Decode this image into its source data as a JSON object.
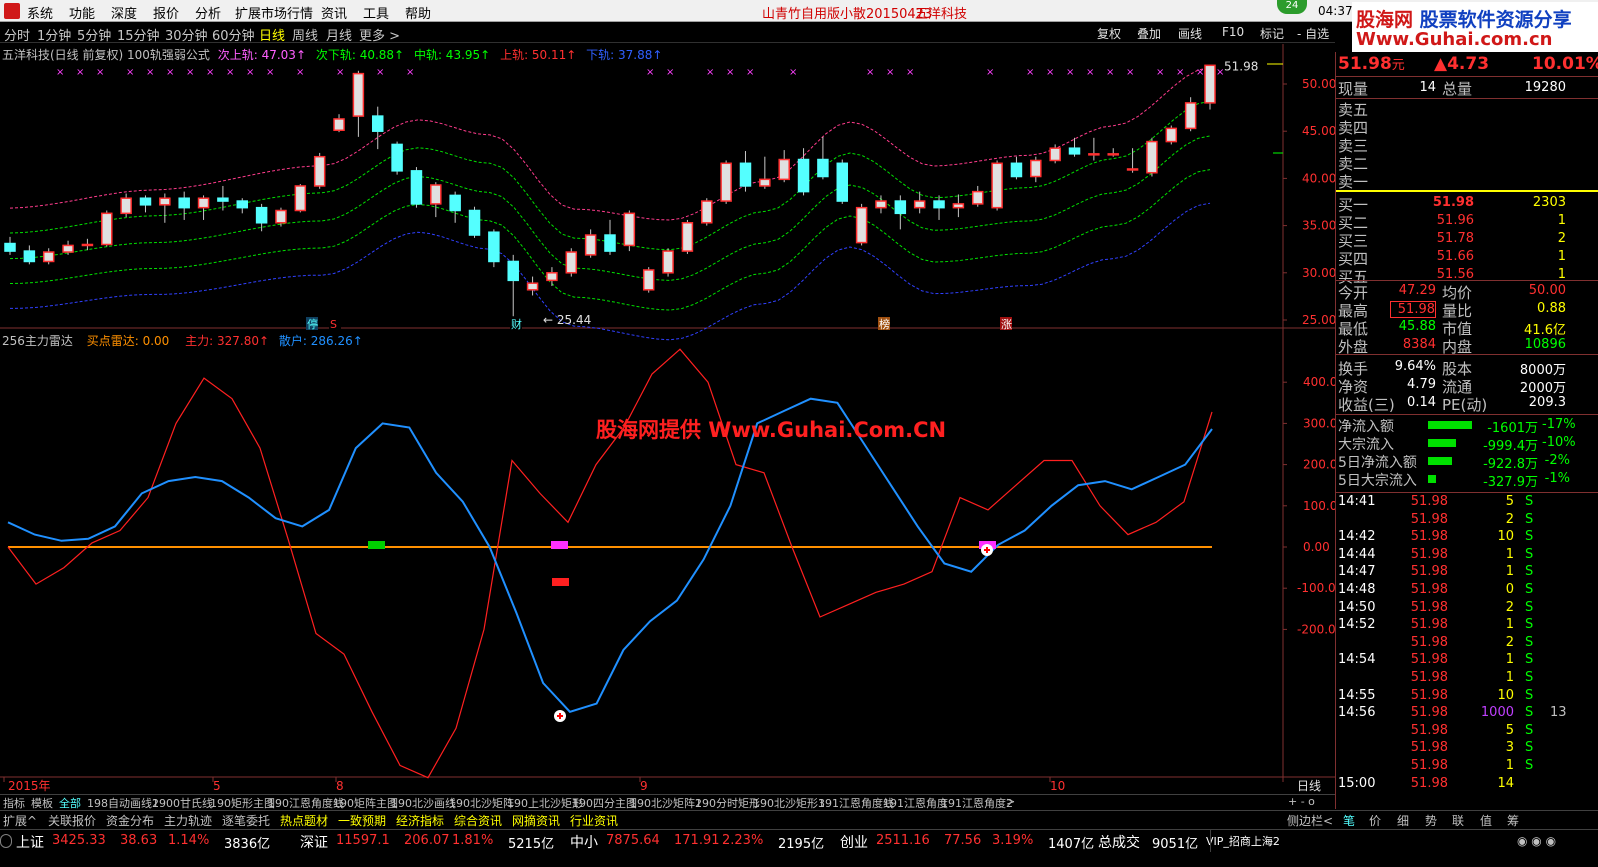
{
  "menu": {
    "items": [
      "系统",
      "功能",
      "深度",
      "报价",
      "分析",
      "扩展市场行情",
      "资讯",
      "工具",
      "帮助"
    ],
    "center_title": "山青竹自用版小散20150423",
    "stock_title": "五洋科技",
    "badge": "24",
    "clock": "04:37",
    "weekday": "周二"
  },
  "ad": {
    "line1_a": "股海网",
    "line1_b": "股票软件资源分享",
    "line2": "Www.Guhai.com.cn"
  },
  "periods": [
    "分时",
    "1分钟",
    "5分钟",
    "15分钟",
    "30分钟",
    "60分钟",
    "日线",
    "周线",
    "月线",
    "更多 >"
  ],
  "toolbar_buttons": [
    "复权",
    "叠加",
    "画线",
    "F10",
    "标记",
    "- 自选"
  ],
  "main_indicator": {
    "name": "五洋科技(日线 前复权) 100轨强弱公式",
    "l1": "次上轨: 47.03↑",
    "l2": "次下轨: 40.88↑",
    "l3": "中轨: 43.95↑",
    "l4": "上轨: 50.11↑",
    "l5": "下轨: 37.88↑"
  },
  "price_axis": [
    "50.00",
    "45.00",
    "40.00",
    "35.00",
    "30.00",
    "25.00"
  ],
  "price_marks": {
    "high": "51.98",
    "low": "25.44"
  },
  "event_tags": [
    "停",
    "S",
    "财",
    "榜",
    "涨"
  ],
  "sub_indicator": {
    "name": "256主力雷达",
    "buy": "买点雷达: 0.00",
    "main": "主力: 327.80↑",
    "retail": "散户: 286.26↑"
  },
  "sub_axis": [
    "400.0",
    "300.0",
    "200.0",
    "100.0",
    "0.00",
    "-100.0",
    "-200.0"
  ],
  "watermark": "股海网提供 Www.Guhai.Com.CN",
  "date_axis": [
    "2015年",
    "5",
    "8",
    "9",
    "10"
  ],
  "date_axis_right": "日线",
  "chart_data": {
    "type": "line",
    "series": [
      {
        "name": "主力",
        "color": "#ff2020",
        "values": [
          0,
          -90,
          -50,
          10,
          40,
          120,
          300,
          410,
          360,
          240,
          20,
          -210,
          -260,
          -400,
          -530,
          -560,
          -440,
          -200,
          210,
          130,
          60,
          200,
          290,
          420,
          480,
          400,
          200,
          180,
          0,
          -170,
          -140,
          -110,
          -90,
          -60,
          120,
          90,
          150,
          210,
          210,
          100,
          30,
          60,
          110,
          327.8
        ]
      },
      {
        "name": "散户",
        "color": "#2090ff",
        "values": [
          60,
          30,
          15,
          20,
          50,
          130,
          160,
          170,
          160,
          120,
          70,
          50,
          90,
          240,
          300,
          290,
          180,
          110,
          0,
          -160,
          -330,
          -400,
          -380,
          -250,
          -180,
          -130,
          -30,
          100,
          300,
          330,
          360,
          350,
          250,
          150,
          50,
          -40,
          -60,
          5,
          40,
          100,
          150,
          160,
          140,
          170,
          200,
          286.3
        ]
      }
    ],
    "ylim": [
      -550,
      480
    ],
    "candles_price_range": [
      25.44,
      51.98
    ],
    "candles": [
      {
        "o": 33.1,
        "c": 32.3,
        "h": 33.8,
        "l": 31.9
      },
      {
        "o": 32.3,
        "c": 31.2,
        "h": 32.9,
        "l": 30.9
      },
      {
        "o": 31.2,
        "c": 32.2,
        "h": 32.6,
        "l": 30.9
      },
      {
        "o": 32.2,
        "c": 32.9,
        "h": 33.4,
        "l": 31.9
      },
      {
        "o": 32.9,
        "c": 33.0,
        "h": 33.6,
        "l": 32.4
      },
      {
        "o": 33.0,
        "c": 36.3,
        "h": 36.6,
        "l": 32.8
      },
      {
        "o": 36.3,
        "c": 37.9,
        "h": 38.4,
        "l": 35.9
      },
      {
        "o": 37.9,
        "c": 37.2,
        "h": 38.2,
        "l": 36.4
      },
      {
        "o": 37.2,
        "c": 37.9,
        "h": 38.4,
        "l": 35.3
      },
      {
        "o": 37.9,
        "c": 36.9,
        "h": 38.6,
        "l": 35.6
      },
      {
        "o": 36.9,
        "c": 37.9,
        "h": 38.2,
        "l": 35.6
      },
      {
        "o": 37.9,
        "c": 37.6,
        "h": 39.2,
        "l": 36.6
      },
      {
        "o": 37.6,
        "c": 36.9,
        "h": 37.9,
        "l": 36.3
      },
      {
        "o": 36.9,
        "c": 35.3,
        "h": 37.3,
        "l": 34.4
      },
      {
        "o": 35.3,
        "c": 36.6,
        "h": 36.9,
        "l": 34.9
      },
      {
        "o": 36.6,
        "c": 39.2,
        "h": 39.4,
        "l": 36.4
      },
      {
        "o": 39.2,
        "c": 42.3,
        "h": 42.7,
        "l": 38.9
      },
      {
        "o": 45.1,
        "c": 46.3,
        "h": 46.8,
        "l": 44.9
      },
      {
        "o": 46.6,
        "c": 51.1,
        "h": 51.4,
        "l": 44.4
      },
      {
        "o": 46.6,
        "c": 45.0,
        "h": 47.6,
        "l": 43.1
      },
      {
        "o": 43.6,
        "c": 40.8,
        "h": 43.9,
        "l": 40.4
      },
      {
        "o": 40.8,
        "c": 37.3,
        "h": 41.2,
        "l": 36.9
      },
      {
        "o": 37.3,
        "c": 39.3,
        "h": 39.6,
        "l": 35.9
      },
      {
        "o": 38.2,
        "c": 36.6,
        "h": 38.6,
        "l": 35.3
      },
      {
        "o": 36.6,
        "c": 34.0,
        "h": 37.0,
        "l": 33.7
      },
      {
        "o": 34.3,
        "c": 31.2,
        "h": 34.6,
        "l": 30.6
      },
      {
        "o": 31.2,
        "c": 29.2,
        "h": 31.9,
        "l": 25.4
      },
      {
        "o": 28.2,
        "c": 28.9,
        "h": 29.6,
        "l": 27.6
      },
      {
        "o": 29.2,
        "c": 30.0,
        "h": 30.6,
        "l": 28.6
      },
      {
        "o": 30.0,
        "c": 32.2,
        "h": 32.6,
        "l": 29.6
      },
      {
        "o": 31.9,
        "c": 34.0,
        "h": 34.6,
        "l": 31.6
      },
      {
        "o": 34.0,
        "c": 32.3,
        "h": 35.6,
        "l": 31.9
      },
      {
        "o": 32.9,
        "c": 36.3,
        "h": 36.6,
        "l": 32.3
      },
      {
        "o": 28.2,
        "c": 30.3,
        "h": 30.6,
        "l": 27.9
      },
      {
        "o": 30.0,
        "c": 32.3,
        "h": 32.6,
        "l": 29.6
      },
      {
        "o": 32.3,
        "c": 35.3,
        "h": 35.6,
        "l": 32.0
      },
      {
        "o": 35.3,
        "c": 37.6,
        "h": 37.9,
        "l": 35.0
      },
      {
        "o": 37.6,
        "c": 41.6,
        "h": 41.9,
        "l": 37.3
      },
      {
        "o": 41.6,
        "c": 39.2,
        "h": 42.9,
        "l": 38.6
      },
      {
        "o": 39.2,
        "c": 39.9,
        "h": 42.3,
        "l": 38.9
      },
      {
        "o": 39.9,
        "c": 42.0,
        "h": 43.0,
        "l": 39.6
      },
      {
        "o": 42.0,
        "c": 38.6,
        "h": 43.2,
        "l": 38.2
      },
      {
        "o": 42.0,
        "c": 40.2,
        "h": 44.4,
        "l": 39.9
      },
      {
        "o": 41.6,
        "c": 37.6,
        "h": 42.0,
        "l": 37.3
      },
      {
        "o": 33.2,
        "c": 36.9,
        "h": 37.3,
        "l": 32.9
      },
      {
        "o": 36.9,
        "c": 37.6,
        "h": 38.2,
        "l": 36.3
      },
      {
        "o": 37.6,
        "c": 36.3,
        "h": 38.2,
        "l": 34.6
      },
      {
        "o": 36.9,
        "c": 37.6,
        "h": 38.6,
        "l": 36.3
      },
      {
        "o": 37.6,
        "c": 36.9,
        "h": 38.2,
        "l": 35.6
      },
      {
        "o": 36.9,
        "c": 37.3,
        "h": 38.3,
        "l": 35.9
      },
      {
        "o": 37.3,
        "c": 38.6,
        "h": 39.2,
        "l": 37.0
      },
      {
        "o": 36.9,
        "c": 41.6,
        "h": 41.9,
        "l": 36.6
      },
      {
        "o": 41.6,
        "c": 40.2,
        "h": 42.3,
        "l": 39.9
      },
      {
        "o": 40.2,
        "c": 41.9,
        "h": 42.3,
        "l": 39.6
      },
      {
        "o": 41.9,
        "c": 43.2,
        "h": 43.6,
        "l": 41.6
      },
      {
        "o": 43.2,
        "c": 42.6,
        "h": 44.3,
        "l": 42.3
      },
      {
        "o": 42.6,
        "c": 42.6,
        "h": 44.3,
        "l": 41.9
      },
      {
        "o": 42.6,
        "c": 42.6,
        "h": 43.2,
        "l": 42.3
      },
      {
        "o": 41.0,
        "c": 41.0,
        "h": 43.2,
        "l": 40.6
      },
      {
        "o": 40.6,
        "c": 43.9,
        "h": 44.3,
        "l": 40.2
      },
      {
        "o": 43.9,
        "c": 45.3,
        "h": 45.6,
        "l": 43.6
      },
      {
        "o": 45.3,
        "c": 48.0,
        "h": 48.6,
        "l": 45.0
      },
      {
        "o": 48.0,
        "c": 51.98,
        "h": 51.98,
        "l": 47.3
      }
    ]
  },
  "quote": {
    "price": "51.98",
    "unit": "元",
    "change": "▲4.73",
    "pct": "10.01%",
    "rows": [
      [
        "现量",
        "14",
        "总量",
        "19280"
      ]
    ],
    "sell": [
      [
        "卖五",
        ""
      ],
      [
        "卖四",
        ""
      ],
      [
        "卖三",
        ""
      ],
      [
        "卖二",
        ""
      ],
      [
        "卖一",
        ""
      ]
    ],
    "buy": [
      [
        "买一",
        "51.98",
        "2303"
      ],
      [
        "买二",
        "51.96",
        "1"
      ],
      [
        "买三",
        "51.78",
        "2"
      ],
      [
        "买四",
        "51.66",
        "1"
      ],
      [
        "买五",
        "51.56",
        "1"
      ]
    ],
    "stats": [
      [
        "今开",
        "47.29",
        "均价",
        "50.00"
      ],
      [
        "最高",
        "51.98",
        "量比",
        "0.88"
      ],
      [
        "最低",
        "45.88",
        "市值",
        "41.6亿"
      ],
      [
        "外盘",
        "8384",
        "内盘",
        "10896"
      ],
      [
        "换手",
        "9.64%",
        "股本",
        "8000万"
      ],
      [
        "净资",
        "4.79",
        "流通",
        "2000万"
      ],
      [
        "收益(三)",
        "0.14",
        "PE(动)",
        "209.3"
      ]
    ],
    "flows": [
      [
        "净流入额",
        "-1601万",
        "-17%"
      ],
      [
        "大宗流入",
        "-999.4万",
        "-10%"
      ],
      [
        "5日净流入额",
        "-922.8万",
        "-2%"
      ],
      [
        "5日大宗流入",
        "-327.9万",
        "-1%"
      ]
    ],
    "ticks": [
      [
        "14:41",
        "51.98",
        "5",
        "S",
        ""
      ],
      [
        "",
        "51.98",
        "2",
        "S",
        ""
      ],
      [
        "14:42",
        "51.98",
        "10",
        "S",
        ""
      ],
      [
        "14:44",
        "51.98",
        "1",
        "S",
        ""
      ],
      [
        "14:47",
        "51.98",
        "1",
        "S",
        ""
      ],
      [
        "14:48",
        "51.98",
        "0",
        "S",
        ""
      ],
      [
        "14:50",
        "51.98",
        "2",
        "S",
        ""
      ],
      [
        "14:52",
        "51.98",
        "1",
        "S",
        ""
      ],
      [
        "",
        "51.98",
        "2",
        "S",
        ""
      ],
      [
        "14:54",
        "51.98",
        "1",
        "S",
        ""
      ],
      [
        "",
        "51.98",
        "1",
        "S",
        ""
      ],
      [
        "14:55",
        "51.98",
        "10",
        "S",
        ""
      ],
      [
        "14:56",
        "51.98",
        "1000",
        "S",
        "13"
      ],
      [
        "",
        "51.98",
        "5",
        "S",
        ""
      ],
      [
        "",
        "51.98",
        "3",
        "S",
        ""
      ],
      [
        "",
        "51.98",
        "1",
        "S",
        ""
      ],
      [
        "15:00",
        "51.98",
        "14",
        "",
        " "
      ]
    ]
  },
  "indicator_tabs": [
    "指标",
    "模板",
    "全部",
    "198自动画线2",
    "1900甘氏线",
    "190矩形主图",
    "190江恩角度线",
    "190矩阵主图",
    "190北沙画线",
    "190北沙矩阵",
    "190上北沙矩形",
    "190四分主图",
    "190北沙矩阵2",
    "190分时矩形",
    "190北沙矩形3",
    "191江恩角度线",
    "191江恩角度",
    "191江恩角度2",
    ">"
  ],
  "link_bar": [
    "扩展^",
    "关联报价",
    "资金分布",
    "主力轨迹",
    "逐笔委托",
    "热点题材",
    "一致预期",
    "经济指标",
    "综合资讯",
    "网摘资讯",
    "行业资讯"
  ],
  "side_tabs": [
    "侧边栏<",
    "笔",
    "价",
    "细",
    "势",
    "联",
    "值",
    "筹"
  ],
  "status": [
    {
      "label": "上证",
      "val": "3425.33",
      "chg": "38.63",
      "pct": "1.14%",
      "amt": "3836亿"
    },
    {
      "label": "深证",
      "val": "11597.1",
      "chg": "206.07",
      "pct": "1.81%",
      "amt": "5215亿"
    },
    {
      "label": "中小",
      "val": "7875.64",
      "chg": "171.91",
      "pct": "2.23%",
      "amt": "2195亿"
    },
    {
      "label": "创业",
      "val": "2511.16",
      "chg": "77.56",
      "pct": "3.19%",
      "amt": "1407亿"
    }
  ],
  "total_label": "总成交",
  "total_val": "9051亿",
  "vip": "VIP_招商上海2",
  "colors": {
    "up": "#ff3030",
    "down": "#54ffff",
    "accent_yellow": "#ffff00",
    "orange": "#ff9000"
  }
}
